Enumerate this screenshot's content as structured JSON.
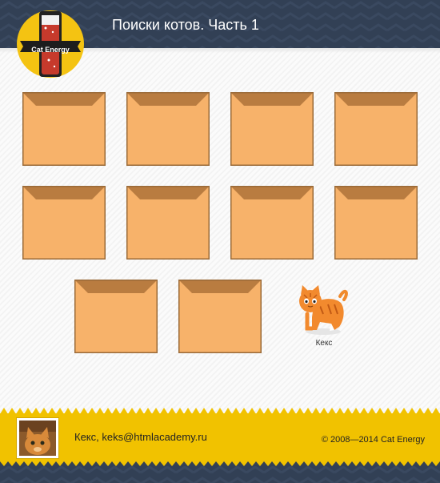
{
  "header": {
    "logo_text": "Cat Energy",
    "title": "Поиски котов. Часть 1"
  },
  "board": {
    "envelope_count": 10,
    "cat": {
      "name": "Кекс",
      "icon": "orange-cat-icon"
    }
  },
  "footer": {
    "contact": "Кекс, keks@htmlacademy.ru",
    "copyright": "© 2008—2014 Cat Energy"
  },
  "colors": {
    "header_bg": "#324055",
    "logo_circle": "#f4c312",
    "envelope_body": "#f7b26a",
    "envelope_flap": "#b97c40",
    "envelope_border": "#9a6a38",
    "footer_bg": "#f1c200"
  }
}
